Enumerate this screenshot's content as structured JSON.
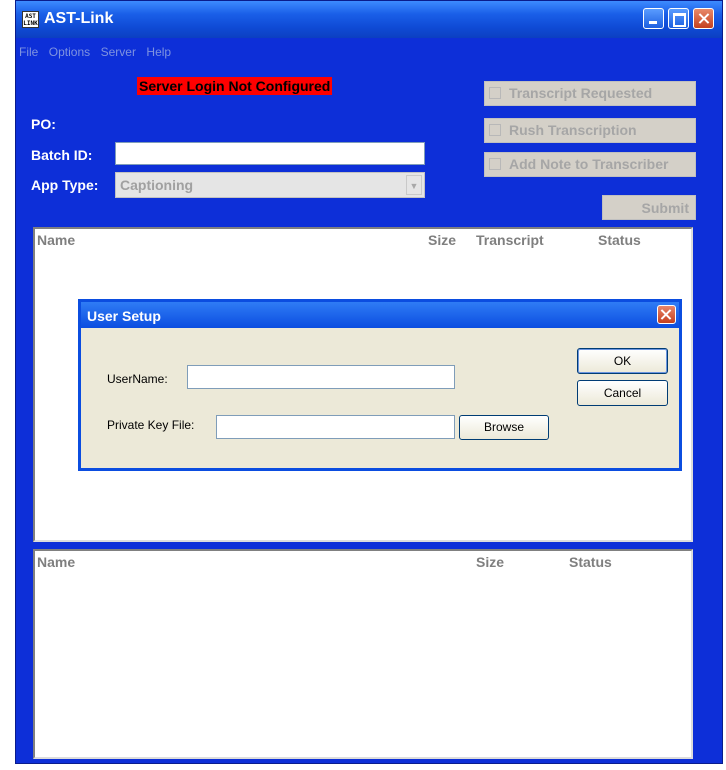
{
  "window": {
    "title": "AST-Link",
    "icon_text": "AST LINK"
  },
  "menu": [
    "File",
    "Options",
    "Server",
    "Help"
  ],
  "notice": "Server Login Not Configured",
  "form": {
    "po_label": "PO:",
    "batch_label": "Batch ID:",
    "batch_value": "",
    "apptype_label": "App Type:",
    "apptype_value": "Captioning"
  },
  "options": {
    "transcript_requested": "Transcript Requested",
    "rush_transcription": "Rush Transcription",
    "add_note": "Add Note to Transcriber",
    "submit": "Submit"
  },
  "upper_list": {
    "headers": [
      "Name",
      "Size",
      "Transcript",
      "Status"
    ]
  },
  "lower_list": {
    "headers": [
      "Name",
      "Size",
      "Status"
    ]
  },
  "dialog": {
    "title": "User Setup",
    "username_label": "UserName:",
    "username_value": "",
    "keyfile_label": "Private Key File:",
    "keyfile_value": "",
    "browse": "Browse",
    "ok": "OK",
    "cancel": "Cancel"
  },
  "colors": {
    "window_bg": "#0d2fd8",
    "notice_bg": "#ff0000",
    "dialog_bg": "#ece9d8"
  }
}
